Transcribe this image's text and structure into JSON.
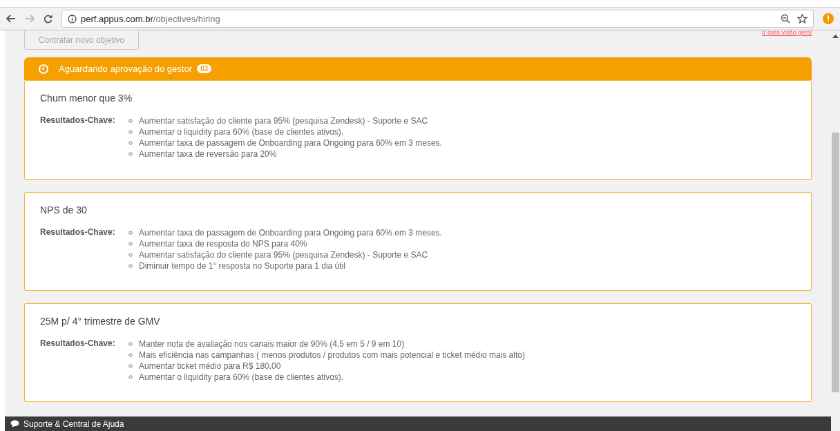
{
  "browser": {
    "url_host": "perf.appus.com.br",
    "url_path": "/objectives/hiring"
  },
  "page": {
    "new_button": "Contratar novo objetivo",
    "overview_link": "Ir para visão geral"
  },
  "group": {
    "title": "Aguardando aprovação do gestor",
    "count": "03"
  },
  "objectives": [
    {
      "title": "Churn menor que 3%",
      "label": "Resultados-Chave:",
      "results": [
        "Aumentar satisfação do cliente para 95% (pesquisa Zendesk) - Suporte e SAC",
        "Aumentar o liquidity para 60% (base de clientes ativos).",
        "Aumentar taxa de passagem de Onboarding para Ongoing para 60% em 3 meses.",
        "Aumentar taxa de reversão para 20%"
      ]
    },
    {
      "title": "NPS de 30",
      "label": "Resultados-Chave:",
      "results": [
        "Aumentar taxa de passagem de Onboarding para Ongoing para 60% em 3 meses.",
        "Aumentar taxa de resposta do NPS para 40%",
        "Aumentar satisfação do cliente para 95% (pesquisa Zendesk) - Suporte e SAC",
        "Diminuir tempo de 1° resposta no Suporte para 1 dia útil"
      ]
    },
    {
      "title": "25M p/ 4° trimestre de GMV",
      "label": "Resultados-Chave:",
      "results": [
        "Manter nota de avaliação nos canais maior de 90% (4,5 em 5 / 9 em 10)",
        "Mais eficiência nas campanhas ( menos produtos / produtos com mais potencial e ticket médio mais alto)",
        "Aumentar ticket médio para R$ 180,00",
        "Aumentar o liquidity para 60% (base de clientes ativos)."
      ]
    }
  ],
  "footer": {
    "help": "Suporte & Central de Ajuda"
  }
}
